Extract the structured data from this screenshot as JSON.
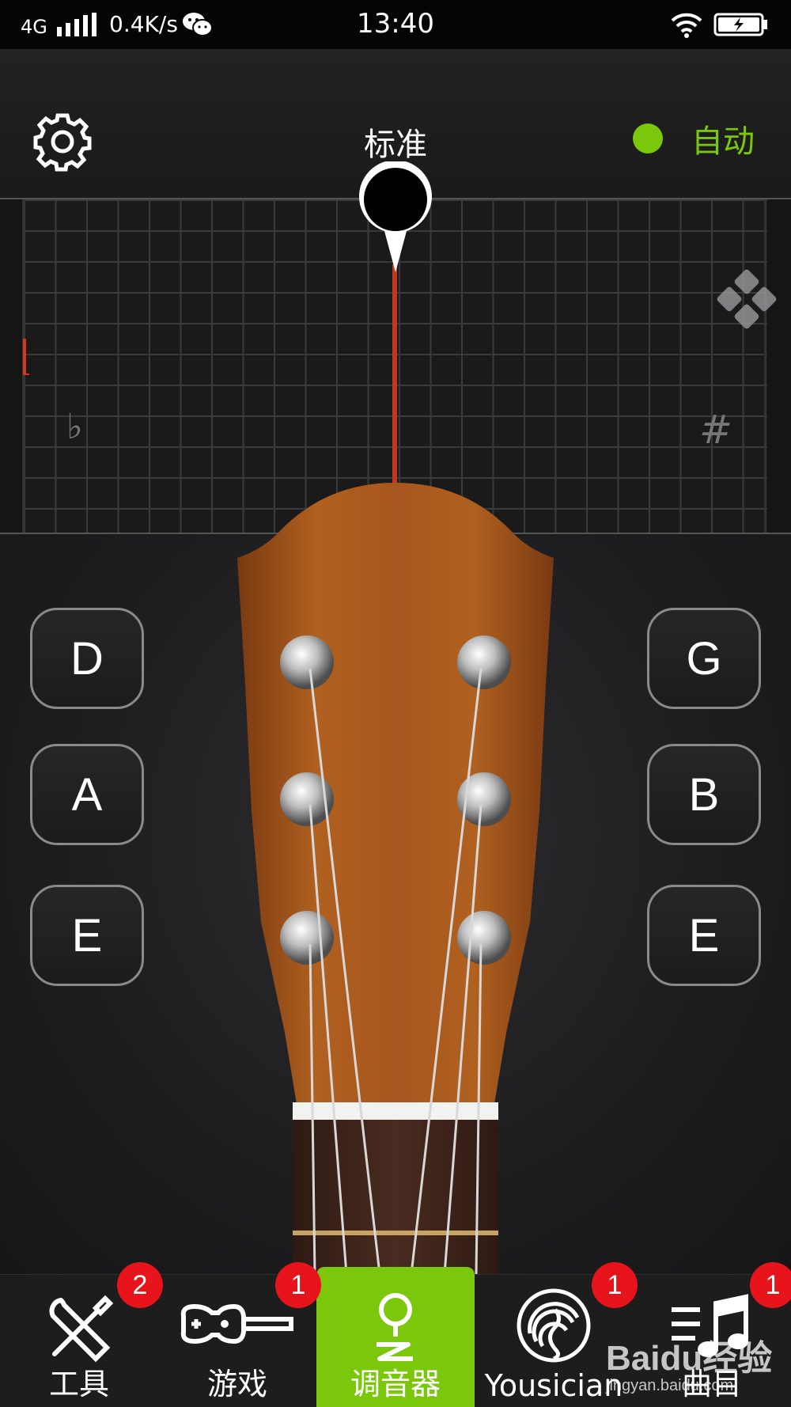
{
  "status_bar": {
    "network": "4G",
    "speed": "0.4K/s",
    "time": "13:40"
  },
  "header": {
    "mode_title": "标准",
    "auto_label": "自动",
    "auto_dot_color": "#7ac70c"
  },
  "tuner": {
    "flat_symbol": "♭",
    "sharp_symbol": "#",
    "needle_color": "#c2381c"
  },
  "strings": {
    "left": [
      "D",
      "A",
      "E"
    ],
    "right": [
      "G",
      "B",
      "E"
    ]
  },
  "tabs": [
    {
      "label": "工具",
      "icon": "tools-icon",
      "badge": "2",
      "active": false
    },
    {
      "label": "游戏",
      "icon": "guitar-game-icon",
      "badge": "1",
      "active": false
    },
    {
      "label": "调音器",
      "icon": "tuner-pin-icon",
      "badge": "",
      "active": true
    },
    {
      "label": "Yousician",
      "icon": "yousician-fingerprint-icon",
      "badge": "1",
      "active": false
    },
    {
      "label": "曲目",
      "icon": "music-notes-icon",
      "badge": "1",
      "active": false
    }
  ],
  "watermark": {
    "brand": "Baidu经验",
    "url": "jingyan.baidu.com"
  },
  "colors": {
    "accent_green": "#7ac70c",
    "badge_red": "#e8141c",
    "wood": "#a8561f"
  }
}
